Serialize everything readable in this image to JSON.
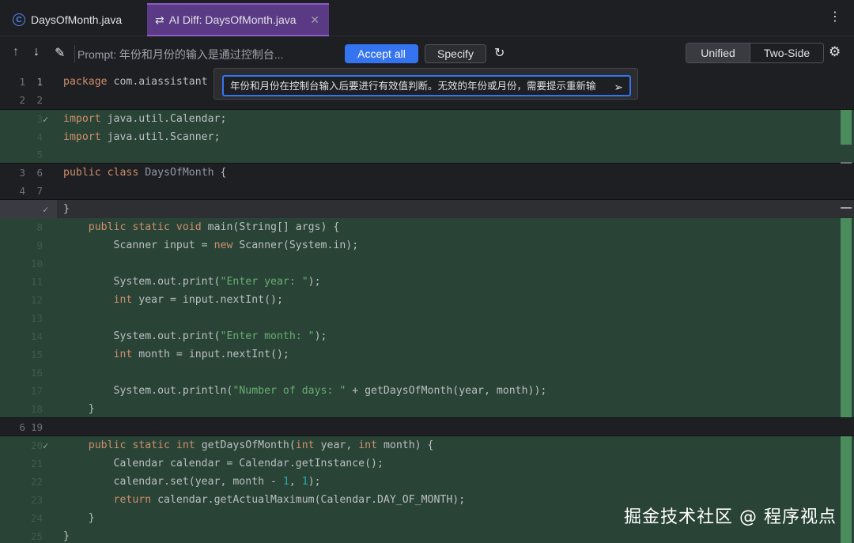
{
  "tabs": [
    {
      "label": "DaysOfMonth.java",
      "icon": "java-class-icon",
      "active": false
    },
    {
      "label": "AI Diff: DaysOfMonth.java",
      "icon": "ai-diff-icon",
      "active": true
    }
  ],
  "toolbar": {
    "prompt": "Prompt: 年份和月份的输入是通过控制台...",
    "accept_all": "Accept all",
    "specify": "Specify",
    "view_unified": "Unified",
    "view_two_side": "Two-Side"
  },
  "popup": {
    "text": "年份和月份在控制台输入后要进行有效值判断。无效的年份或月份，需要提示重新输"
  },
  "lines": [
    {
      "old": "1",
      "new": "1",
      "code": "package com.aiassistant"
    },
    {
      "old": "2",
      "new": "2",
      "code": ""
    },
    {
      "old": "",
      "new": "3",
      "code": "import java.util.Calendar;"
    },
    {
      "old": "",
      "new": "4",
      "code": "import java.util.Scanner;"
    },
    {
      "old": "",
      "new": "5",
      "code": ""
    },
    {
      "old": "3",
      "new": "6",
      "code": "public class DaysOfMonth {"
    },
    {
      "old": "4",
      "new": "7",
      "code": ""
    },
    {
      "old": "",
      "new": "",
      "code": "}"
    },
    {
      "old": "",
      "new": "8",
      "code": "    public static void main(String[] args) {"
    },
    {
      "old": "",
      "new": "9",
      "code": "        Scanner input = new Scanner(System.in);"
    },
    {
      "old": "",
      "new": "10",
      "code": ""
    },
    {
      "old": "",
      "new": "11",
      "code": "        System.out.print(\"Enter year: \");"
    },
    {
      "old": "",
      "new": "12",
      "code": "        int year = input.nextInt();"
    },
    {
      "old": "",
      "new": "13",
      "code": ""
    },
    {
      "old": "",
      "new": "14",
      "code": "        System.out.print(\"Enter month: \");"
    },
    {
      "old": "",
      "new": "15",
      "code": "        int month = input.nextInt();"
    },
    {
      "old": "",
      "new": "16",
      "code": ""
    },
    {
      "old": "",
      "new": "17",
      "code": "        System.out.println(\"Number of days: \" + getDaysOfMonth(year, month));"
    },
    {
      "old": "",
      "new": "18",
      "code": "    }"
    },
    {
      "old": "6",
      "new": "19",
      "code": ""
    },
    {
      "old": "",
      "new": "20",
      "code": "    public static int getDaysOfMonth(int year, int month) {"
    },
    {
      "old": "",
      "new": "21",
      "code": "        Calendar calendar = Calendar.getInstance();"
    },
    {
      "old": "",
      "new": "22",
      "code": "        calendar.set(year, month - 1, 1);"
    },
    {
      "old": "",
      "new": "23",
      "code": "        return calendar.getActualMaximum(Calendar.DAY_OF_MONTH);"
    },
    {
      "old": "",
      "new": "24",
      "code": "    }"
    },
    {
      "old": "",
      "new": "25",
      "code": "}"
    }
  ],
  "watermark": "掘金技术社区 @ 程序视点"
}
